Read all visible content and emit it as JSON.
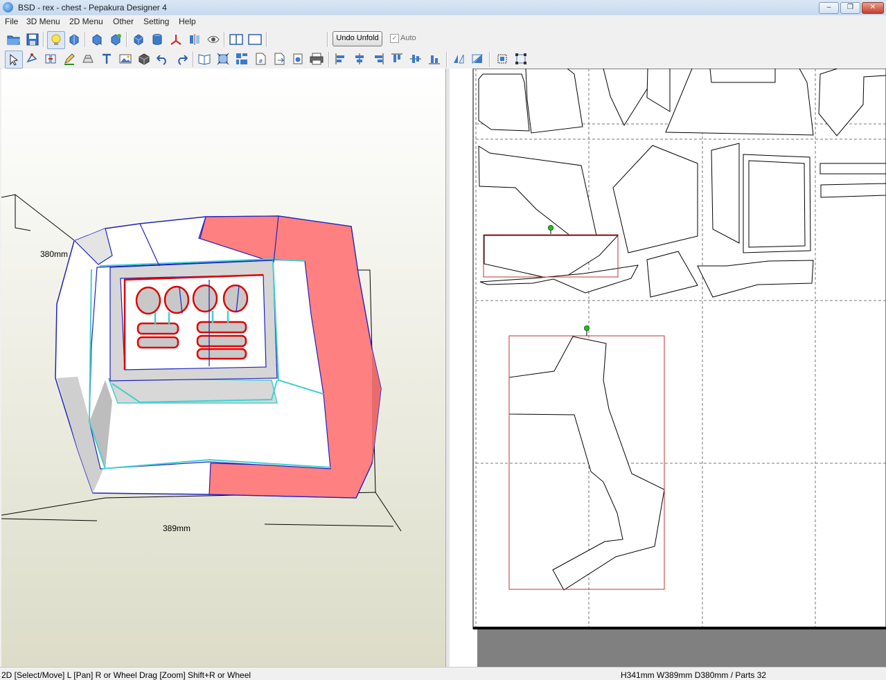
{
  "window": {
    "title": "BSD - rex - chest - Pepakura Designer 4",
    "minimize": "–",
    "maximize": "❐",
    "close": "✕"
  },
  "menu": [
    "File",
    "3D Menu",
    "2D Menu",
    "Other",
    "Setting",
    "Help"
  ],
  "toolbar": {
    "undo_unfold_label": "Undo Unfold",
    "auto_label": "Auto",
    "auto_checked_mark": "✓"
  },
  "icons": {
    "row1": [
      "open-folder-icon",
      "save-icon",
      "light-bulb-icon",
      "rotate-model-icon",
      "rotate-model-alt-icon",
      "cube-edit-icon",
      "cylinder-icon",
      "axis-icon",
      "mirror-icon",
      "eye-icon",
      "split-view-icon",
      "single-view-icon"
    ],
    "row2": [
      "select-move-icon",
      "edge-edit-icon",
      "join-parts-icon",
      "pen-icon",
      "flap-icon",
      "text-icon",
      "image-icon",
      "box-icon",
      "undo-icon",
      "redo-icon",
      "book-icon",
      "fit-icon",
      "arrange-icon",
      "page-number-icon",
      "export-icon",
      "print-setup-icon",
      "print-icon",
      "align-left-icon",
      "align-center-icon",
      "align-right-icon",
      "align-top-icon",
      "align-middle-icon",
      "align-bottom-icon",
      "flip-horizontal-icon",
      "flip-vertical-icon",
      "group-icon",
      "scale-icon"
    ]
  },
  "view3d": {
    "height_label": "380mm",
    "width_label": "389mm"
  },
  "status": {
    "left": "2D [Select/Move] L [Pan] R or Wheel Drag [Zoom] Shift+R or Wheel",
    "right": "H341mm W389mm D380mm / Parts 32"
  },
  "colors": {
    "accent_red": "#ff8080",
    "edge_blue": "#2020c0",
    "edge_cyan": "#40d0d0",
    "cut_red": "#e00000"
  }
}
